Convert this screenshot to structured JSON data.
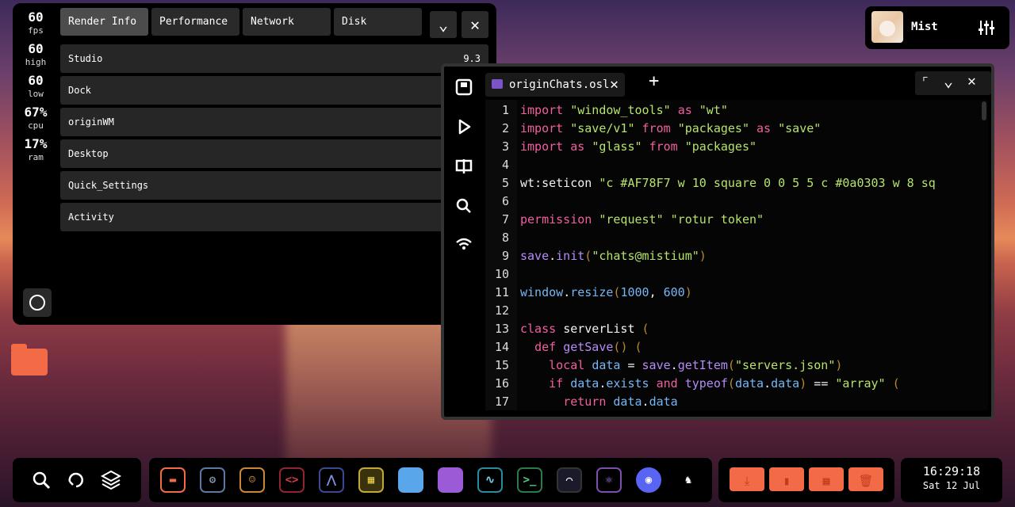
{
  "stats": [
    {
      "value": "60",
      "label": "fps"
    },
    {
      "value": "60",
      "label": "high"
    },
    {
      "value": "60",
      "label": "low"
    },
    {
      "value": "67%",
      "label": "cpu"
    },
    {
      "value": "17%",
      "label": "ram"
    }
  ],
  "tabs": [
    "Render Info",
    "Performance",
    "Network",
    "Disk"
  ],
  "rows": [
    {
      "label": "Studio",
      "value": "9.3"
    },
    {
      "label": "Dock"
    },
    {
      "label": "originWM"
    },
    {
      "label": "Desktop"
    },
    {
      "label": "Quick_Settings"
    },
    {
      "label": "Activity"
    }
  ],
  "user": {
    "name": "Mist"
  },
  "editor": {
    "tab": "originChats.osl"
  },
  "code_lines": [
    {
      "n": "1",
      "text": "import \"window_tools\" as \"wt\""
    },
    {
      "n": "2",
      "text": "import \"save/v1\" from \"packages\" as \"save\""
    },
    {
      "n": "3",
      "text": "import as \"glass\" from \"packages\""
    },
    {
      "n": "4",
      "text": ""
    },
    {
      "n": "5",
      "text": "wt:seticon \"c #AF78F7 w 10 square 0 0 5 5 c #0a0303 w 8 sq"
    },
    {
      "n": "6",
      "text": ""
    },
    {
      "n": "7",
      "text": "permission \"request\" \"rotur token\""
    },
    {
      "n": "8",
      "text": ""
    },
    {
      "n": "9",
      "text": "save.init(\"chats@mistium\")"
    },
    {
      "n": "10",
      "text": ""
    },
    {
      "n": "11",
      "text": "window.resize(1000, 600)"
    },
    {
      "n": "12",
      "text": ""
    },
    {
      "n": "13",
      "text": "class serverList ("
    },
    {
      "n": "14",
      "text": "  def getSave() ("
    },
    {
      "n": "15",
      "text": "    local data = save.getItem(\"servers.json\")"
    },
    {
      "n": "16",
      "text": "    if data.exists and typeof(data.data) == \"array\" ("
    },
    {
      "n": "17",
      "text": "      return data.data"
    }
  ],
  "clock": {
    "time": "16:29:18",
    "date": "Sat 12 Jul"
  },
  "icons": {
    "dock_left": [
      "search-icon",
      "refresh-icon",
      "layers-icon"
    ],
    "dock_main": [
      "folder-icon",
      "settings-icon",
      "contacts-icon",
      "code-icon",
      "wave-icon",
      "widgets-icon",
      "chat-icon",
      "message-icon",
      "pulse-icon",
      "terminal-icon",
      "curve-icon",
      "atom-icon",
      "discord-icon",
      "robot-icon"
    ],
    "dock_folders": [
      "download-icon",
      "document-icon",
      "grid-icon",
      "trash-icon"
    ]
  },
  "colors": {
    "accent": "#f26b46",
    "keyword": "#f25fa0",
    "string": "#b6e36a",
    "function": "#b58cf7",
    "number": "#76b6f4"
  }
}
